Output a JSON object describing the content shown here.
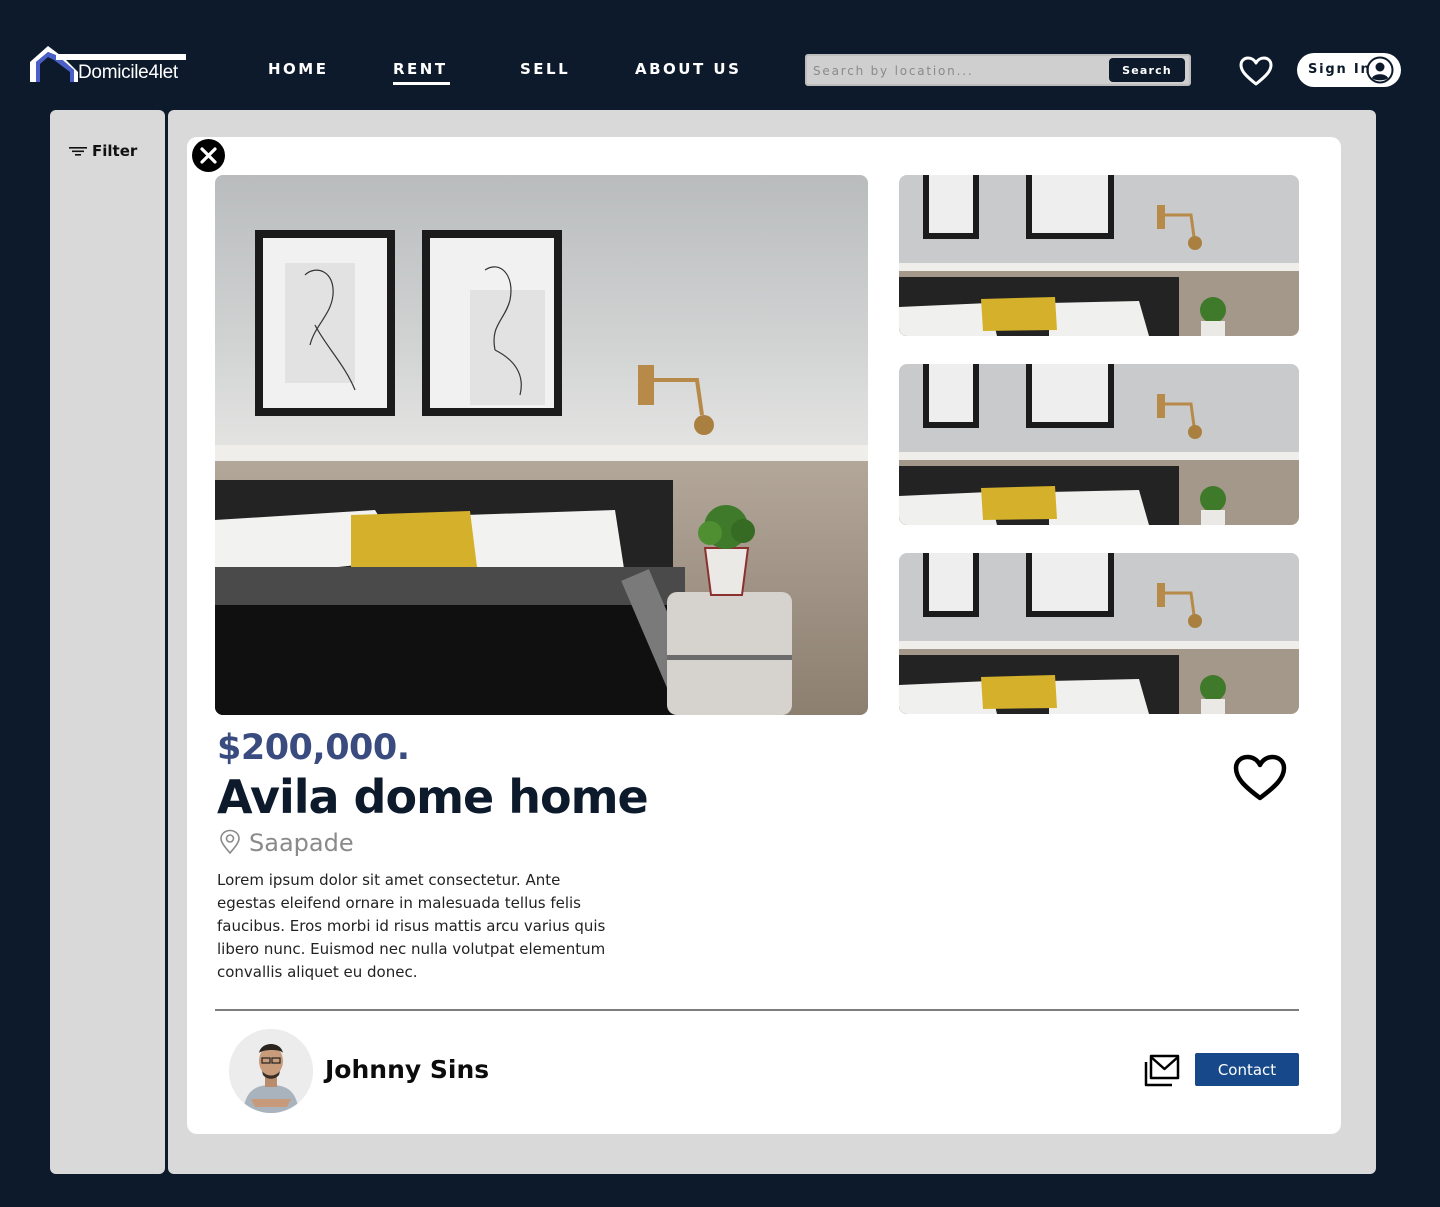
{
  "brand": {
    "name": "Domicile4let"
  },
  "nav": {
    "items": [
      {
        "label": "HOME",
        "active": false
      },
      {
        "label": "RENT",
        "active": true
      },
      {
        "label": "SELL",
        "active": false
      },
      {
        "label": "ABOUT US",
        "active": false
      }
    ]
  },
  "search": {
    "placeholder": "Search by location...",
    "button_label": "Search"
  },
  "header": {
    "favorites_icon": "heart-icon",
    "signin_label": "Sign In",
    "avatar_icon": "user-circle-icon"
  },
  "sidebar": {
    "filter_label": "Filter",
    "filter_icon": "filter-lines-icon"
  },
  "listing": {
    "price": "$200,000.",
    "title": "Avila dome home",
    "location": "Saapade",
    "description": "Lorem ipsum dolor sit amet consectetur. Ante egestas eleifend ornare in malesuada tellus felis faucibus. Eros morbi id risus mattis arcu varius quis libero nunc. Euismod nec nulla volutpat elementum convallis aliquet eu donec.",
    "photos": [
      "main-photo",
      "thumbnail-1",
      "thumbnail-2",
      "thumbnail-3"
    ]
  },
  "agent": {
    "name": "Johnny Sins",
    "contact_label": "Contact",
    "mail_icon": "mail-icon"
  },
  "colors": {
    "background": "#0c1a2b",
    "panel": "#d9d9d9",
    "price": "#3a4b7f",
    "contact_button": "#17498a",
    "logo_accent": "#4b5fc8"
  }
}
